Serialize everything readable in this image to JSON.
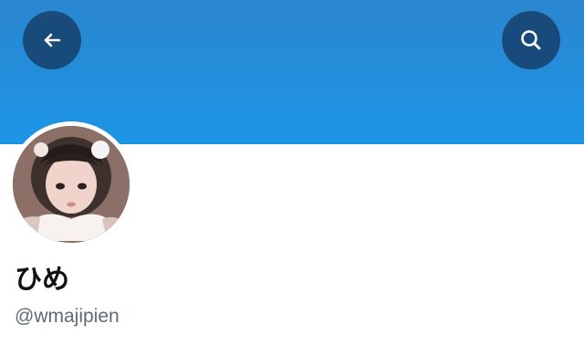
{
  "header": {
    "banner_color": "#1d95e6",
    "back_icon": "arrow-left-icon",
    "search_icon": "search-icon"
  },
  "profile": {
    "display_name": "ひめ",
    "handle": "@wmajipien",
    "avatar_icon": "profile-photo"
  }
}
